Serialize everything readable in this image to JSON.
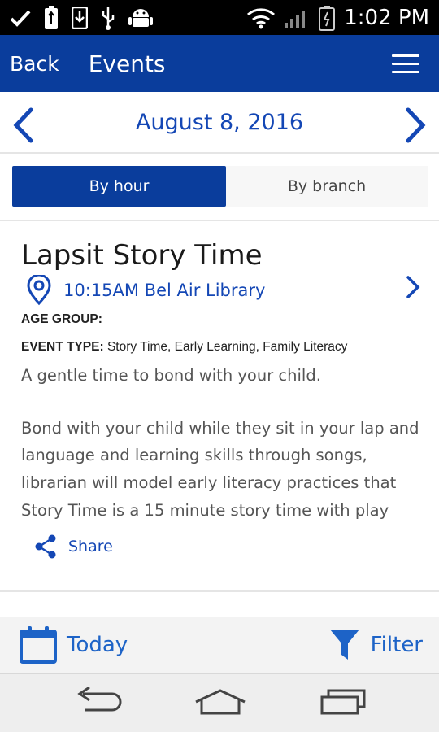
{
  "status_bar": {
    "time": "1:02 PM",
    "icons": [
      "check-icon",
      "usb-battery-icon",
      "download-icon",
      "usb-icon",
      "android-icon",
      "wifi-icon",
      "signal-icon",
      "battery-icon"
    ]
  },
  "app_bar": {
    "back_label": "Back",
    "title": "Events",
    "menu_icon": "hamburger-menu-icon"
  },
  "date_nav": {
    "date": "August 8, 2016"
  },
  "view_toggle": {
    "by_hour": "By hour",
    "by_branch": "By branch",
    "selected": "By hour"
  },
  "event": {
    "title": "Lapsit Story Time",
    "time_location": "10:15AM Bel Air Library",
    "age_group_label": "AGE GROUP:",
    "age_group_value": "",
    "event_type_label": "EVENT TYPE:",
    "event_type_value": "Story Time, Early Learning, Family Literacy",
    "description_lines": [
      "A gentle time to bond with your child.",
      "",
      "Bond with your child while they sit in your lap and",
      "language and learning skills through songs,",
      "librarian will model early literacy practices that",
      "Story Time is a 15 minute story time with play"
    ],
    "share_label": "Share"
  },
  "bottom_bar": {
    "today_label": "Today",
    "filter_label": "Filter"
  },
  "colors": {
    "primary": "#0a3d9c",
    "link": "#1447b5",
    "accent": "#1d63c7"
  }
}
